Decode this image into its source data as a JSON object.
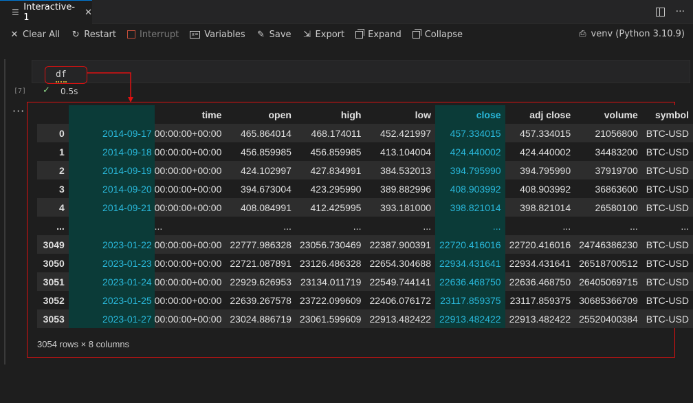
{
  "tab": {
    "title": "Interactive-1",
    "icon": "list-icon",
    "close": "✕"
  },
  "toolbar": {
    "clear_all": "Clear All",
    "restart": "Restart",
    "interrupt": "Interrupt",
    "variables": "Variables",
    "save": "Save",
    "export": "Export",
    "expand": "Expand",
    "collapse": "Collapse",
    "kernel": "venv (Python 3.10.9)"
  },
  "cell": {
    "index": "[7]",
    "code": "df",
    "exec_time": "0.5s",
    "output_menu": "···"
  },
  "table": {
    "columns": [
      "",
      "time",
      "open",
      "high",
      "low",
      "close",
      "adj close",
      "volume",
      "symbol"
    ],
    "rows": [
      [
        "0",
        "2014-09-17",
        "00:00:00+00:00",
        "465.864014",
        "468.174011",
        "452.421997",
        "457.334015",
        "457.334015",
        "21056800",
        "BTC-USD"
      ],
      [
        "1",
        "2014-09-18",
        "00:00:00+00:00",
        "456.859985",
        "456.859985",
        "413.104004",
        "424.440002",
        "424.440002",
        "34483200",
        "BTC-USD"
      ],
      [
        "2",
        "2014-09-19",
        "00:00:00+00:00",
        "424.102997",
        "427.834991",
        "384.532013",
        "394.795990",
        "394.795990",
        "37919700",
        "BTC-USD"
      ],
      [
        "3",
        "2014-09-20",
        "00:00:00+00:00",
        "394.673004",
        "423.295990",
        "389.882996",
        "408.903992",
        "408.903992",
        "36863600",
        "BTC-USD"
      ],
      [
        "4",
        "2014-09-21",
        "00:00:00+00:00",
        "408.084991",
        "412.425995",
        "393.181000",
        "398.821014",
        "398.821014",
        "26580100",
        "BTC-USD"
      ],
      [
        "...",
        "",
        "...",
        "...",
        "...",
        "...",
        "...",
        "...",
        "...",
        "..."
      ],
      [
        "3049",
        "2023-01-22",
        "00:00:00+00:00",
        "22777.986328",
        "23056.730469",
        "22387.900391",
        "22720.416016",
        "22720.416016",
        "24746386230",
        "BTC-USD"
      ],
      [
        "3050",
        "2023-01-23",
        "00:00:00+00:00",
        "22721.087891",
        "23126.486328",
        "22654.304688",
        "22934.431641",
        "22934.431641",
        "26518700512",
        "BTC-USD"
      ],
      [
        "3051",
        "2023-01-24",
        "00:00:00+00:00",
        "22929.626953",
        "23134.011719",
        "22549.744141",
        "22636.468750",
        "22636.468750",
        "26405069715",
        "BTC-USD"
      ],
      [
        "3052",
        "2023-01-25",
        "00:00:00+00:00",
        "22639.267578",
        "23722.099609",
        "22406.076172",
        "23117.859375",
        "23117.859375",
        "30685366709",
        "BTC-USD"
      ],
      [
        "3053",
        "2023-01-27",
        "00:00:00+00:00",
        "23024.886719",
        "23061.599609",
        "22913.482422",
        "22913.482422",
        "22913.482422",
        "25520400384",
        "BTC-USD"
      ]
    ],
    "shape": "3054 rows × 8 columns"
  },
  "colors": {
    "highlight_text": "#29b8db",
    "highlight_bg": "#0b3b38",
    "annotation": "#e01010",
    "success": "#89d185"
  }
}
